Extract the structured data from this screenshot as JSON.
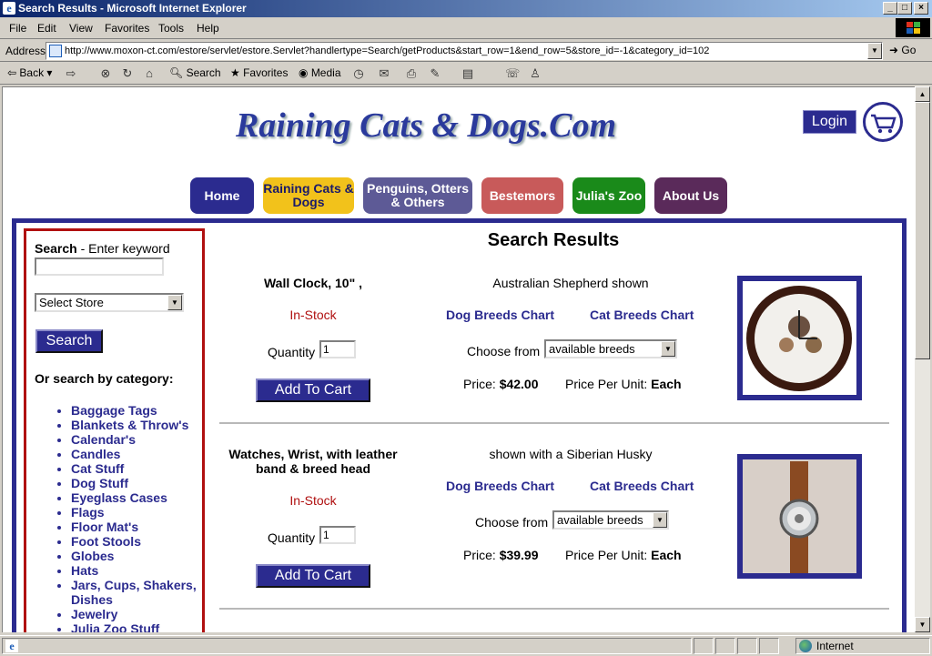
{
  "window": {
    "title": "Search Results - Microsoft Internet Explorer"
  },
  "menu": [
    "File",
    "Edit",
    "View",
    "Favorites",
    "Tools",
    "Help"
  ],
  "address": {
    "label": "Address",
    "url": "http://www.moxon-ct.com/estore/servlet/estore.Servlet?handlertype=Search/getProducts&start_row=1&end_row=5&store_id=-1&category_id=102",
    "go": "Go"
  },
  "toolbar": {
    "back": "Back",
    "search": "Search",
    "favorites": "Favorites",
    "media": "Media"
  },
  "status": {
    "zone": "Internet"
  },
  "site": {
    "title": "Raining Cats & Dogs.Com",
    "login": "Login",
    "nav": [
      {
        "label": "Home",
        "color": "#2b2b8f"
      },
      {
        "label": "Raining Cats & Dogs",
        "color": "#f2c21b"
      },
      {
        "label": "Penguins, Otters & Others",
        "color": "#5d5a96"
      },
      {
        "label": "Bestemors",
        "color": "#c85a5a"
      },
      {
        "label": "Julia's Zoo",
        "color": "#1a8a1a"
      },
      {
        "label": "About Us",
        "color": "#5a2a5a"
      }
    ]
  },
  "sidebar": {
    "search_bold": "Search",
    "search_rest": " - Enter keyword",
    "store_select": "Select Store",
    "search_button": "Search",
    "category_label": "Or search by category:",
    "categories": [
      "Baggage Tags",
      "Blankets & Throw's",
      "Calendar's",
      "Candles",
      "Cat Stuff",
      "Dog Stuff",
      "Eyeglass Cases",
      "Flags",
      "Floor Mat's",
      "Foot Stools",
      "Globes",
      "Hats",
      "Jars, Cups, Shakers, Dishes",
      "Jewelry",
      "Julia Zoo Stuff"
    ]
  },
  "results": {
    "title": "Search Results",
    "products": [
      {
        "name": "Wall Clock, 10\" ,",
        "stock": "In-Stock",
        "qty_label": "Quantity",
        "qty": "1",
        "add": "Add To Cart",
        "desc": "Australian Shepherd shown",
        "dog_chart": "Dog Breeds Chart",
        "cat_chart": "Cat Breeds Chart",
        "choose": "Choose from",
        "breeds": "available breeds",
        "price_label": "Price: ",
        "price": "$42.00",
        "unit_label": "Price Per Unit: ",
        "unit": "Each"
      },
      {
        "name": "Watches, Wrist, with leather band & breed head",
        "stock": "In-Stock",
        "qty_label": "Quantity",
        "qty": "1",
        "add": "Add To Cart",
        "desc": "shown with a Siberian Husky",
        "dog_chart": "Dog Breeds Chart",
        "cat_chart": "Cat Breeds Chart",
        "choose": "Choose from",
        "breeds": "available breeds",
        "price_label": "Price: ",
        "price": "$39.99",
        "unit_label": "Price Per Unit: ",
        "unit": "Each"
      }
    ]
  }
}
